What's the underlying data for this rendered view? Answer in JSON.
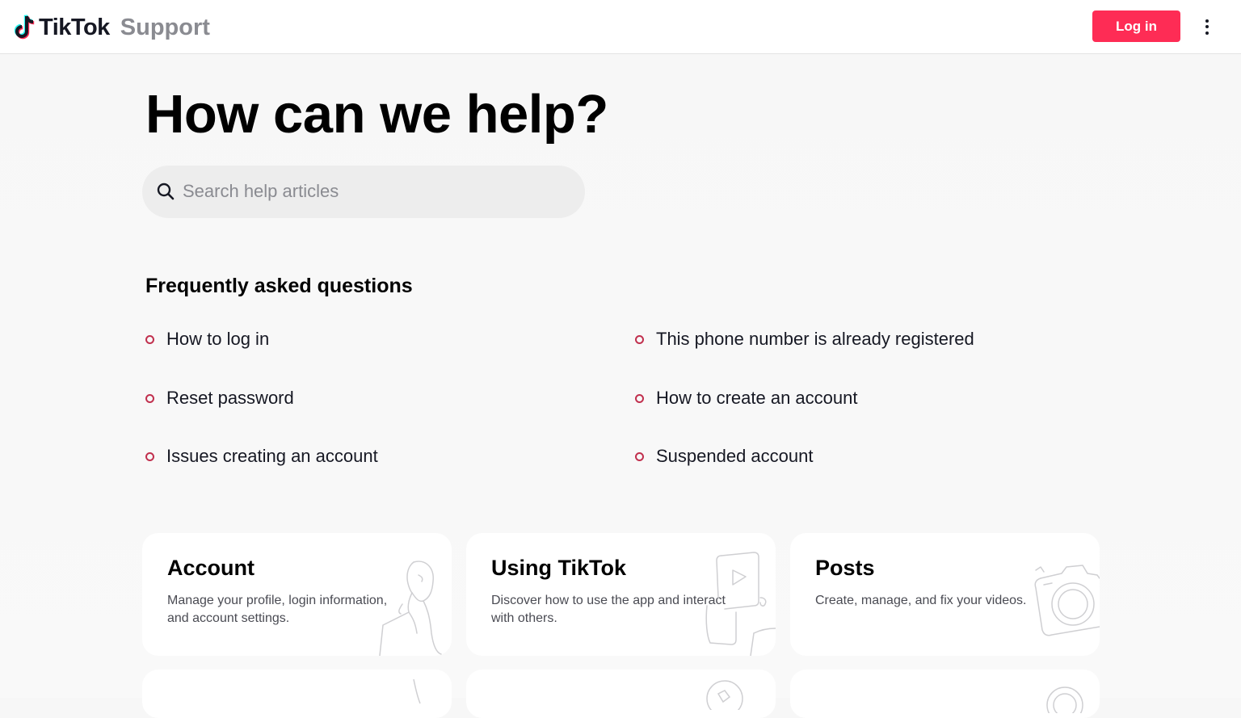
{
  "header": {
    "brand": "TikTok",
    "section": "Support",
    "login_label": "Log in",
    "brand_colors": {
      "cyan": "#25f4ee",
      "red": "#fe2c55"
    }
  },
  "hero": {
    "title": "How can we help?",
    "search_placeholder": "Search help articles"
  },
  "faq": {
    "heading": "Frequently asked questions",
    "items": [
      "How to log in",
      "This phone number is already registered",
      "Reset password",
      "How to create an account",
      "Issues creating an account",
      "Suspended account"
    ]
  },
  "cards": [
    {
      "title": "Account",
      "desc": "Manage your profile, login information, and account settings.",
      "icon": "person-illustration"
    },
    {
      "title": "Using TikTok",
      "desc": "Discover how to use the app and interact with others.",
      "icon": "phone-play-illustration"
    },
    {
      "title": "Posts",
      "desc": "Create, manage, and fix your videos.",
      "icon": "camera-illustration"
    }
  ],
  "colors": {
    "accent": "#fe2c55",
    "bullet": "#c1304e"
  }
}
